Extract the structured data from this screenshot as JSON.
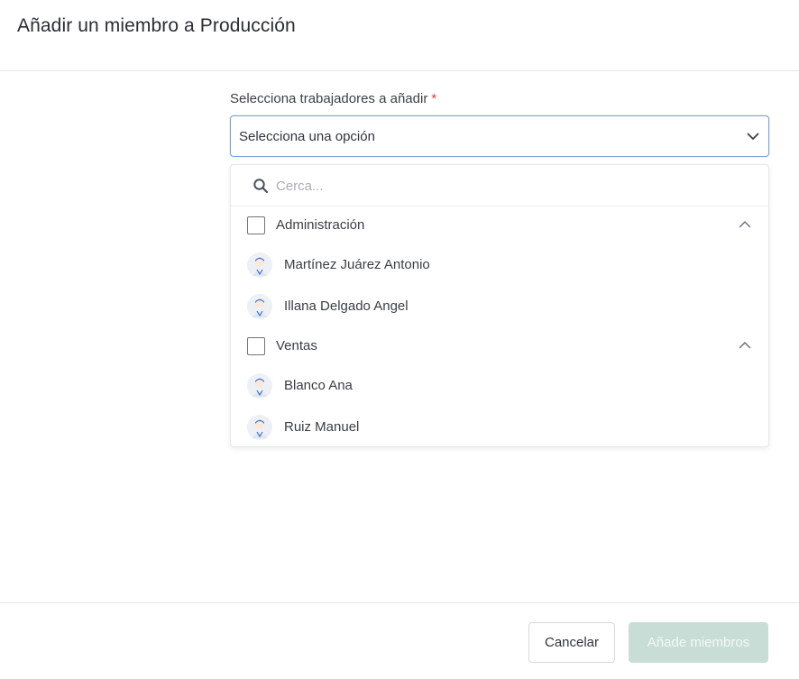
{
  "modal": {
    "title": "Añadir un miembro a Producción"
  },
  "form": {
    "label": "Selecciona trabajadores a añadir",
    "required_marker": "*",
    "select_value": "Selecciona una opción"
  },
  "dropdown": {
    "search_placeholder": "Cerca...",
    "groups": [
      {
        "label": "Administración",
        "members": [
          "Martínez Juárez Antonio",
          "Illana Delgado Angel"
        ]
      },
      {
        "label": "Ventas",
        "members": [
          "Blanco Ana",
          "Ruiz Manuel"
        ]
      }
    ]
  },
  "footer": {
    "cancel_label": "Cancelar",
    "add_label": "Añade miembros"
  },
  "colors": {
    "required": "#e0413a",
    "focus_border": "#7f9ed6",
    "primary_disabled": "#c8ddd5",
    "avatar_accent": "#3d6fc4"
  },
  "icons": {
    "select_chevron": "chevron-down-icon",
    "search": "search-icon",
    "group_toggle": "chevron-up-icon",
    "avatar": "user-avatar-icon"
  }
}
